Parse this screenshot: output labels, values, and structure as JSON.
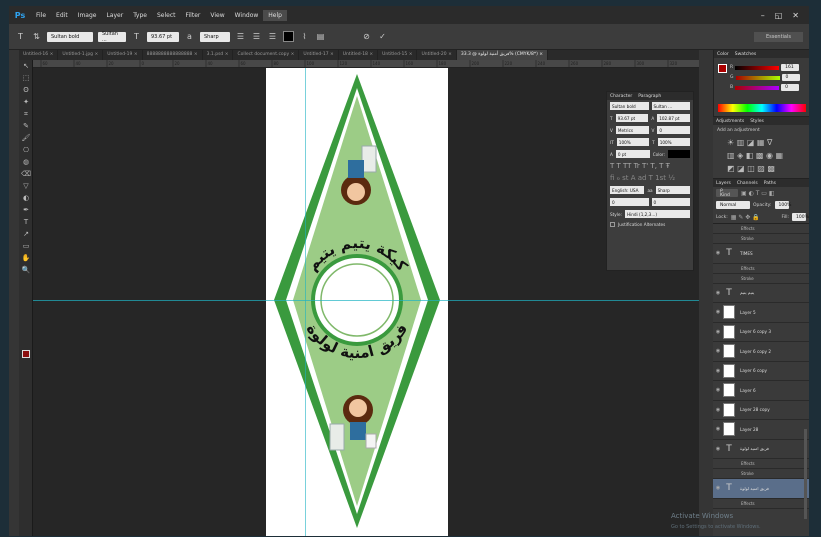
{
  "app": {
    "logo": "Ps"
  },
  "menu": [
    "File",
    "Edit",
    "Image",
    "Layer",
    "Type",
    "Select",
    "Filter",
    "View",
    "Window",
    "Help"
  ],
  "window_controls": [
    "–",
    "◱",
    "✕"
  ],
  "options": {
    "font_family": "Sultan bold",
    "font_style": "Sultan ...",
    "font_size": "93.67 pt",
    "aa": "Sharp",
    "workspace": "Essentials"
  },
  "tabs": [
    {
      "label": "Untitled-16 ×"
    },
    {
      "label": "Untitled-1.jpg ×"
    },
    {
      "label": "Untitled-19 ×"
    },
    {
      "label": "8888888888888888 ×"
    },
    {
      "label": "3.1.psd ×"
    },
    {
      "label": "Collect document.copy ×"
    },
    {
      "label": "Untitled-17 ×"
    },
    {
      "label": "Untitled-18 ×"
    },
    {
      "label": "Untitled-15 ×"
    },
    {
      "label": "Untitled-20 ×"
    },
    {
      "label": "فريق أمنية لولوة @ 33.3% (CMYK/8*) ×"
    }
  ],
  "ruler": [
    "60",
    "40",
    "20",
    "0",
    "20",
    "40",
    "60",
    "80",
    "100",
    "120",
    "140",
    "160",
    "180",
    "200",
    "220",
    "240",
    "260",
    "280",
    "300",
    "320"
  ],
  "tools": [
    "↖",
    "⬚",
    "ʘ",
    "✦",
    "⌗",
    "✎",
    "🖌",
    "⎔",
    "◍",
    "⌫",
    "▽",
    "◐",
    "✒",
    "T",
    "↗",
    "▭",
    "✋",
    "🔍"
  ],
  "artwork": {
    "text_top": "كيكة يتيم يتيم",
    "text_bottom": "فريق امنية لولوة"
  },
  "colors": {
    "frame_green": "#3a9a3e",
    "fill_green": "#9ccc86",
    "accent": "#1fb3c3",
    "fg": "#8b0e0e"
  },
  "color_panel": {
    "tabs": [
      "Color",
      "Swatches"
    ],
    "r": "161",
    "g": "0",
    "b": "0"
  },
  "character_panel": {
    "tabs": [
      "Character",
      "Paragraph"
    ],
    "font_family": "Sultan bold",
    "font_style": "Sultan ...",
    "size": "93.67 pt",
    "leading": "102.87 pt",
    "kerning": "Metrics",
    "tracking": "0",
    "vscale": "100%",
    "hscale": "100%",
    "baseline": "0 pt",
    "color_label": "Color:",
    "language": "English: USA",
    "aa": "Sharp",
    "style_label": "Style:",
    "style_value": "Hindi (1,2,3...)",
    "justification": "Justification Alternates",
    "lang2": "0",
    "lang3": "0"
  },
  "adjustments": {
    "tabs": [
      "Adjustments",
      "Styles"
    ],
    "add_label": "Add an adjustment"
  },
  "layers": {
    "tabs": [
      "Layers",
      "Channels",
      "Paths"
    ],
    "kind": "ρ Kind",
    "blend": "Normal",
    "opacity_label": "Opacity:",
    "opacity": "100%",
    "lock_label": "Lock:",
    "fill_label": "Fill:",
    "fill": "100%",
    "items": [
      {
        "name": "Effects",
        "sub": true
      },
      {
        "name": "Stroke",
        "sub": true
      },
      {
        "name": "TIMES",
        "icon": "T"
      },
      {
        "name": "Effects",
        "sub": true
      },
      {
        "name": "Stroke",
        "sub": true
      },
      {
        "name": "يتيم يتيم",
        "icon": "T"
      },
      {
        "name": "Layer 5"
      },
      {
        "name": "Layer 6 copy 3"
      },
      {
        "name": "Layer 6 copy 2"
      },
      {
        "name": "Layer 6 copy"
      },
      {
        "name": "Layer 6"
      },
      {
        "name": "Layer 28 copy"
      },
      {
        "name": "Layer 28"
      },
      {
        "name": "فريق امنية لولوة",
        "icon": "T"
      },
      {
        "name": "Effects",
        "sub": true
      },
      {
        "name": "Stroke",
        "sub": true
      },
      {
        "name": "فريق امنية لولوة",
        "icon": "T",
        "hl": true
      },
      {
        "name": "Effects",
        "sub": true
      }
    ]
  },
  "watermark": {
    "title": "Activate Windows",
    "sub": "Go to Settings to activate Windows."
  }
}
